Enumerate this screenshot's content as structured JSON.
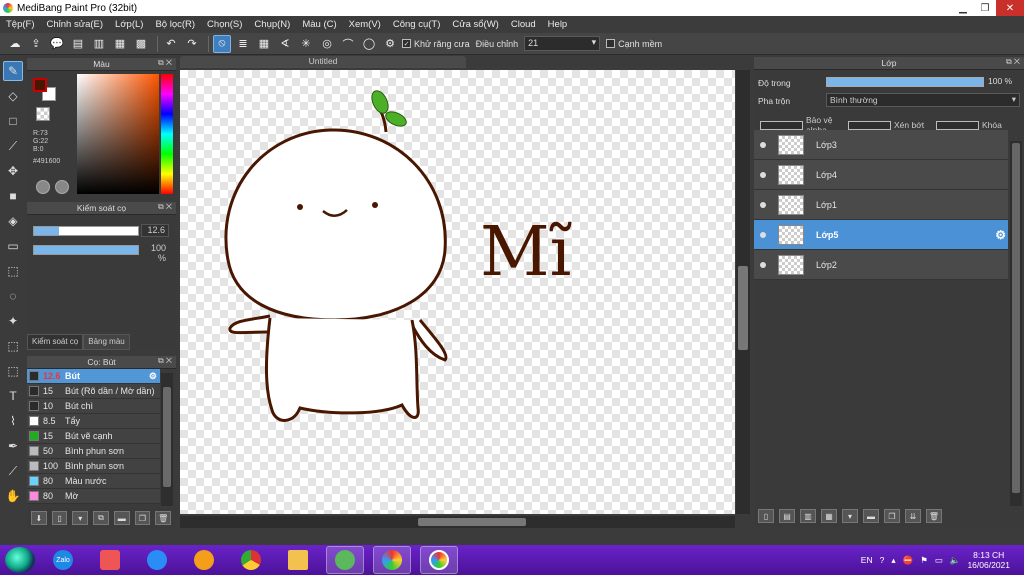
{
  "window": {
    "title": "MediBang Paint Pro (32bit)",
    "min": "▁",
    "max": "❐",
    "close": "✕"
  },
  "menu": [
    "Tệp(F)",
    "Chỉnh sửa(E)",
    "Lớp(L)",
    "Bộ lọc(R)",
    "Chọn(S)",
    "Chụp(N)",
    "Màu (C)",
    "Xem(V)",
    "Công cụ(T)",
    "Cửa sổ(W)",
    "Cloud",
    "Help"
  ],
  "toolbar": {
    "antialias_label": "Khử răng cưa",
    "correction_label": "Điều chỉnh",
    "correction_value": "21",
    "edge_label": "Cạnh mềm"
  },
  "color_panel": {
    "title": "Màu",
    "primary_color": "#491600",
    "secondary_color": "#ffffff",
    "r": "R:73",
    "g": "G:22",
    "b": "B:0",
    "hex": "#491600"
  },
  "brush_control": {
    "title": "Kiểm soát cọ",
    "size": "12.6",
    "opacity": "100 %",
    "size_fraction": 0.24,
    "opacity_fraction": 1.0
  },
  "tabs": [
    "Kiểm soát cọ",
    "Bảng màu"
  ],
  "brush_panel": {
    "title": "Cọ: Bút",
    "items": [
      {
        "size": "12.6",
        "name": "Bút",
        "color": "#2b2b2b",
        "selected": true
      },
      {
        "size": "15",
        "name": "Bút (Rõ dần / Mờ dần)",
        "color": "#2b2b2b"
      },
      {
        "size": "10",
        "name": "Bút chì",
        "color": "#2b2b2b"
      },
      {
        "size": "8.5",
        "name": "Tẩy",
        "color": "#ffffff"
      },
      {
        "size": "15",
        "name": "Bút vẽ cạnh",
        "color": "#22aa22"
      },
      {
        "size": "50",
        "name": "Bình phun sơn",
        "color": "#bbbbbb"
      },
      {
        "size": "100",
        "name": "Bình phun sơn",
        "color": "#bbbbbb"
      },
      {
        "size": "80",
        "name": "Màu nước",
        "color": "#6ad0ff"
      },
      {
        "size": "80",
        "name": "Mờ",
        "color": "#ff88dd"
      }
    ]
  },
  "document": {
    "tab_title": "Untitled",
    "drawing_text": "Mĩ",
    "ink_color": "#491600"
  },
  "layer_panel": {
    "title": "Lớp",
    "opacity_label": "Độ trong",
    "opacity_value": "100 %",
    "blend_label": "Pha trộn",
    "blend_value": "Bình thường",
    "protect_alpha": "Bảo vệ alpha",
    "clipping": "Xén bớt",
    "lock": "Khóa",
    "layers": [
      {
        "name": "Lớp3",
        "selected": false
      },
      {
        "name": "Lớp4",
        "selected": false
      },
      {
        "name": "Lớp1",
        "selected": false
      },
      {
        "name": "Lớp5",
        "selected": true
      },
      {
        "name": "Lớp2",
        "selected": false
      }
    ]
  },
  "taskbar": {
    "apps": [
      "zalo",
      "media",
      "ie",
      "browser",
      "chrome",
      "explorer",
      "app-green",
      "paint",
      "medibang"
    ],
    "zalo_label": "Zalo",
    "lang": "EN",
    "time": "8:13 CH",
    "date": "16/06/2021"
  }
}
